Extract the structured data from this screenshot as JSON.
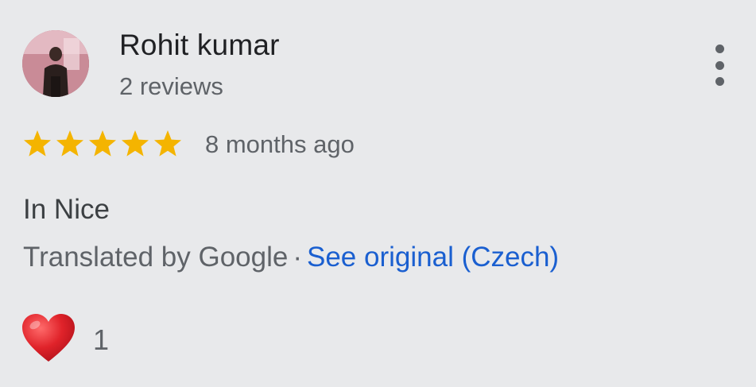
{
  "review": {
    "author": {
      "name": "Rohit kumar",
      "reviews_count_text": "2 reviews",
      "avatar_icon": "user-avatar-photo"
    },
    "more_options_icon": "more-vert-icon",
    "rating": {
      "stars": 5,
      "max_stars": 5,
      "star_color": "#f4b400"
    },
    "time_text": "8 months ago",
    "text": "In Nice",
    "translation": {
      "label": "Translated by Google",
      "separator": "·",
      "link_text": "See original (Czech)",
      "link_color": "#1a5fd0"
    },
    "reaction": {
      "icon": "heart-icon",
      "color": "#e0232a",
      "count": "1"
    }
  }
}
